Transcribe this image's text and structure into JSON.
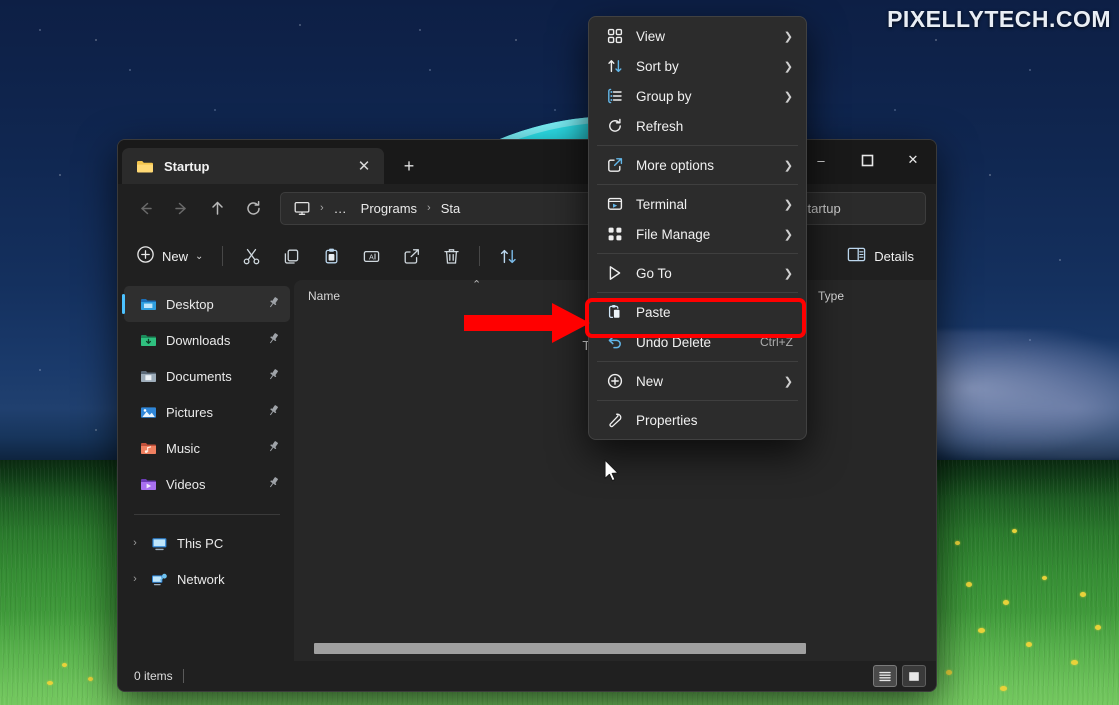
{
  "desktop": {
    "watermark": "PIXELLYTECH.COM"
  },
  "window": {
    "tab": {
      "title": "Startup",
      "icon": "folder-icon",
      "close_label": "✕",
      "new_tab_label": "+"
    },
    "controls": {
      "minimize": "–",
      "maximize": "◻",
      "close": "✕"
    },
    "nav": {
      "back": "←",
      "forward": "→",
      "up": "↑",
      "refresh": "⟳",
      "breadcrumb": [
        {
          "label": "",
          "icon": "monitor-icon"
        },
        {
          "label": "…",
          "icon": "overflow-icon"
        },
        {
          "label": "Programs",
          "icon": ""
        },
        {
          "label": "Sta",
          "icon": ""
        }
      ],
      "separator": "›"
    },
    "search": {
      "placeholder": "Search Startup",
      "value": "rch Startup",
      "icon": "search-icon"
    },
    "toolbar": {
      "new_label": "New",
      "new_chevron": "⌄",
      "items": [
        {
          "name": "cut",
          "label": "Cut"
        },
        {
          "name": "copy",
          "label": "Copy"
        },
        {
          "name": "paste",
          "label": "Paste"
        },
        {
          "name": "rename",
          "label": "Rename"
        },
        {
          "name": "share",
          "label": "Share"
        },
        {
          "name": "delete",
          "label": "Delete"
        },
        {
          "name": "sort",
          "label": "Sort"
        }
      ],
      "details_label": "Details"
    },
    "sidebar": {
      "quick_items": [
        {
          "label": "Desktop",
          "icon": "desktop-icon",
          "pinned": true,
          "selected": true
        },
        {
          "label": "Downloads",
          "icon": "downloads-icon",
          "pinned": true,
          "selected": false
        },
        {
          "label": "Documents",
          "icon": "documents-icon",
          "pinned": true,
          "selected": false
        },
        {
          "label": "Pictures",
          "icon": "pictures-icon",
          "pinned": true,
          "selected": false
        },
        {
          "label": "Music",
          "icon": "music-icon",
          "pinned": true,
          "selected": false
        },
        {
          "label": "Videos",
          "icon": "videos-icon",
          "pinned": true,
          "selected": false
        }
      ],
      "tree_items": [
        {
          "label": "This PC",
          "icon": "this-pc-icon",
          "chevron": "›"
        },
        {
          "label": "Network",
          "icon": "network-icon",
          "chevron": "›"
        }
      ],
      "pin_glyph": "📌"
    },
    "content": {
      "columns": [
        {
          "label": "Name",
          "sort": "asc",
          "sort_glyph": "⌃"
        },
        {
          "label": "Type",
          "sort": ""
        }
      ],
      "empty_message": "This folder is empty.",
      "visible_empty_text": "This fo"
    },
    "status": {
      "item_count": "0 items",
      "views": [
        {
          "name": "details-view",
          "active": true
        },
        {
          "name": "large-icons-view",
          "active": false
        }
      ]
    }
  },
  "context_menu": {
    "groups": [
      {
        "items": [
          {
            "label": "View",
            "icon": "grid-icon",
            "submenu": true,
            "accel": ""
          },
          {
            "label": "Sort by",
            "icon": "sort-arrows-icon",
            "submenu": true,
            "accel": ""
          },
          {
            "label": "Group by",
            "icon": "group-list-icon",
            "submenu": true,
            "accel": ""
          },
          {
            "label": "Refresh",
            "icon": "refresh-icon",
            "submenu": false,
            "accel": ""
          }
        ]
      },
      {
        "items": [
          {
            "label": "More options",
            "icon": "more-options-icon",
            "submenu": true,
            "accel": ""
          }
        ]
      },
      {
        "items": [
          {
            "label": "Terminal",
            "icon": "terminal-icon",
            "submenu": true,
            "accel": ""
          },
          {
            "label": "File Manage",
            "icon": "file-manage-icon",
            "submenu": true,
            "accel": ""
          }
        ]
      },
      {
        "items": [
          {
            "label": "Go To",
            "icon": "goto-cursor-icon",
            "submenu": true,
            "accel": ""
          }
        ]
      },
      {
        "items": [
          {
            "label": "Paste",
            "icon": "paste-icon",
            "submenu": false,
            "accel": "",
            "highlighted": true
          },
          {
            "label": "Undo Delete",
            "icon": "undo-icon",
            "submenu": false,
            "accel": "Ctrl+Z"
          }
        ]
      },
      {
        "items": [
          {
            "label": "New",
            "icon": "new-plus-icon",
            "submenu": true,
            "accel": ""
          }
        ]
      },
      {
        "items": [
          {
            "label": "Properties",
            "icon": "wrench-icon",
            "submenu": false,
            "accel": ""
          }
        ]
      }
    ],
    "submenu_glyph": "❯"
  },
  "annotations": {
    "highlight_color": "#ff0000",
    "arrow_target": "Paste"
  }
}
